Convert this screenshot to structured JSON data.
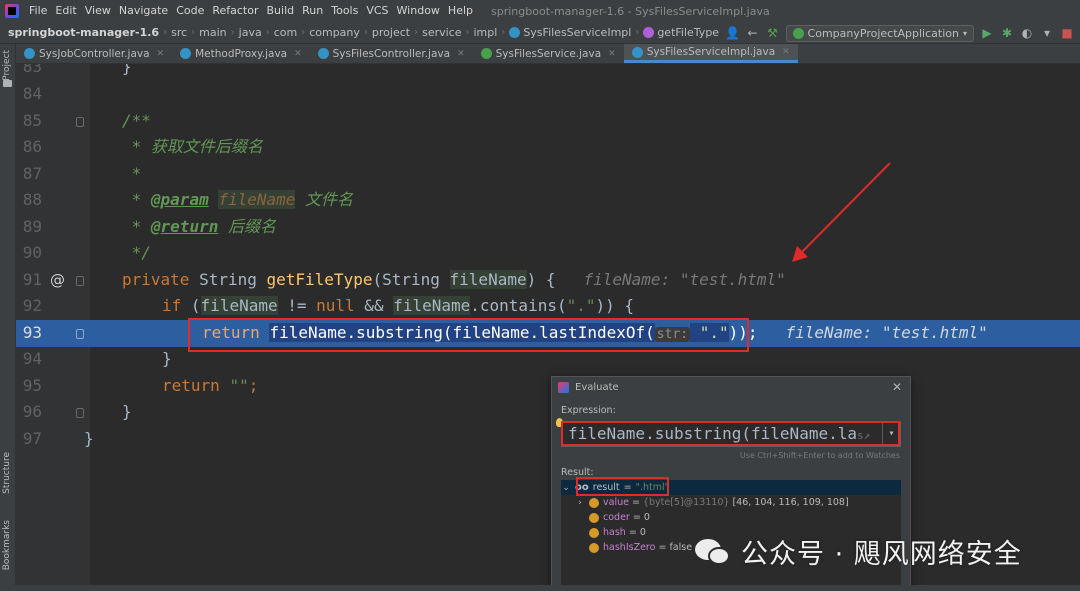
{
  "menu": {
    "items": [
      "File",
      "Edit",
      "View",
      "Navigate",
      "Code",
      "Refactor",
      "Build",
      "Run",
      "Tools",
      "VCS",
      "Window",
      "Help"
    ],
    "window_title": "springboot-manager-1.6 - SysFilesServiceImpl.java"
  },
  "breadcrumbs": [
    "springboot-manager-1.6",
    "src",
    "main",
    "java",
    "com",
    "company",
    "project",
    "service",
    "impl",
    "SysFilesServiceImpl",
    "getFileType"
  ],
  "toolbar": {
    "run_config": "CompanyProjectApplication"
  },
  "left_strip": {
    "project_label": "Project",
    "structure_label": "Structure",
    "bookmarks_label": "Bookmarks"
  },
  "tabs": [
    {
      "label": "SysJobController.java",
      "icon": "class-icon"
    },
    {
      "label": "MethodProxy.java",
      "icon": "class-icon"
    },
    {
      "label": "SysFilesController.java",
      "icon": "class-icon"
    },
    {
      "label": "SysFilesService.java",
      "icon": "interface-icon"
    },
    {
      "label": "SysFilesServiceImpl.java",
      "icon": "class-icon"
    }
  ],
  "editor": {
    "line_numbers": [
      "83",
      "84",
      "85",
      "86",
      "87",
      "88",
      "89",
      "90",
      "91",
      "92",
      "93",
      "94",
      "95",
      "96",
      "97"
    ],
    "l83": "}",
    "l85": "/**",
    "l86": " * 获取文件后缀名",
    "l87": " *",
    "l88_star": " * ",
    "l88_tag": "@param",
    "l88_name": "fileName",
    "l88_desc": " 文件名",
    "l89_star": " * ",
    "l89_tag": "@return",
    "l89_desc": " 后缀名",
    "l90": " */",
    "l91_kw": "private ",
    "l91_type": "String ",
    "l91_fn": "getFileType",
    "l91_a": "(String ",
    "l91_param": "fileName",
    "l91_b": ") {",
    "l91_hint": "fileName: \"test.html\"",
    "l92_kw": "if ",
    "l92_a": "(",
    "l92_p1": "fileName",
    "l92_b": " != ",
    "l92_null": "null",
    "l92_c": " && ",
    "l92_p2": "fileName",
    "l92_d": ".contains(",
    "l92_str": "\".\"",
    "l92_e": ")) {",
    "l93_kw": "return ",
    "l93_a": "fileName.substring(fileName.lastIndexOf(",
    "l93_inlay": "str:",
    "l93_str": " \".\"",
    "l93_b": "));",
    "l93_hint": "fileName: \"test.html\"",
    "l94": "}",
    "l95_kw": "return ",
    "l95_str": "\"\"",
    "l95_end": ";",
    "l96": "}",
    "l97": "}",
    "override_mark": "@"
  },
  "evaluate": {
    "title": "Evaluate",
    "expression_label": "Expression:",
    "expression_value": "fileName.substring(fileName.la",
    "expression_ellipsis": "s↗",
    "hint": "Use Ctrl+Shift+Enter to add to Watches",
    "result_label": "Result:",
    "result_name": "result",
    "result_value": "\".html\"",
    "fields": [
      {
        "name": "value",
        "eq": " = ",
        "type": "{byte[5]@13110}",
        "val": " [46, 104, 116, 109, 108]"
      },
      {
        "name": "coder",
        "eq": " = ",
        "type": "",
        "val": "0"
      },
      {
        "name": "hash",
        "eq": " = ",
        "type": "",
        "val": "0"
      },
      {
        "name": "hashIsZero",
        "eq": " = ",
        "type": "",
        "val": "false"
      }
    ]
  },
  "watermark": {
    "text": "公众号 · 飓风网络安全"
  },
  "colors": {
    "execution_line": "#2d5fa0",
    "annotation_red": "#e02b2b",
    "keyword": "#cc7832",
    "string": "#6a8759",
    "function": "#ffc66d"
  }
}
